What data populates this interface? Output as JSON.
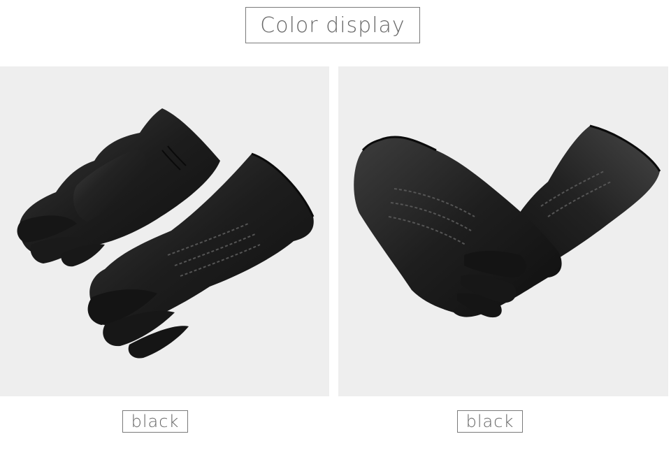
{
  "title": "Color display",
  "panels": [
    {
      "label": "black"
    },
    {
      "label": "black"
    }
  ],
  "colors": {
    "panel_background": "#eeeeee",
    "glove": "#1c1c1c",
    "border": "#7a7a7a",
    "text": "#666666"
  }
}
